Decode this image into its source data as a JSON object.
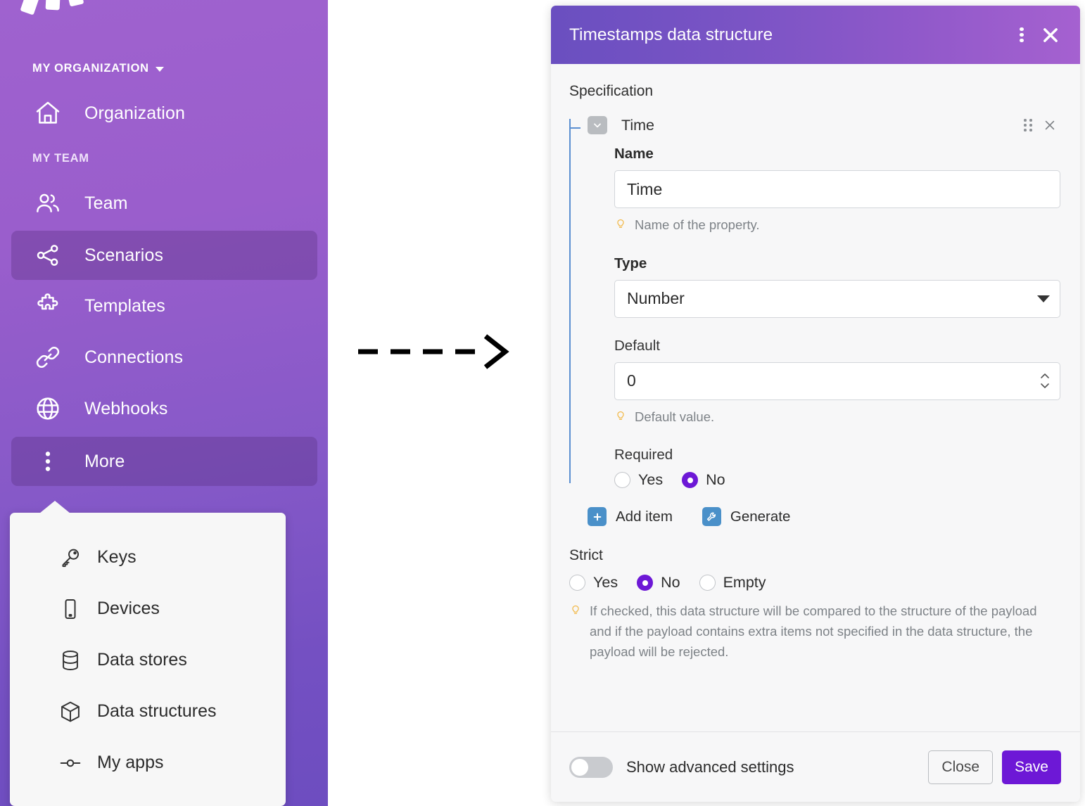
{
  "sidebar": {
    "logo_icon": "make-logo",
    "org_header": {
      "label": "MY ORGANIZATION",
      "icon": "chevron-down-icon"
    },
    "team_header": "MY TEAM",
    "items": [
      {
        "label": "Organization",
        "icon": "home-icon",
        "active": false
      },
      {
        "label": "Team",
        "icon": "people-icon",
        "active": false
      },
      {
        "label": "Scenarios",
        "icon": "share-nodes-icon",
        "active": true
      },
      {
        "label": "Templates",
        "icon": "puzzle-icon",
        "active": false
      },
      {
        "label": "Connections",
        "icon": "link-icon",
        "active": false
      },
      {
        "label": "Webhooks",
        "icon": "globe-icon",
        "active": false
      },
      {
        "label": "More",
        "icon": "kebab-icon",
        "active": true
      }
    ]
  },
  "popup_menu": {
    "items": [
      {
        "label": "Keys",
        "icon": "key-icon"
      },
      {
        "label": "Devices",
        "icon": "device-icon"
      },
      {
        "label": "Data stores",
        "icon": "database-icon"
      },
      {
        "label": "Data structures",
        "icon": "cube-icon"
      },
      {
        "label": "My apps",
        "icon": "node-icon"
      }
    ]
  },
  "flow": {
    "arrow_icon": "dashed-arrow-right-icon"
  },
  "modal": {
    "title": "Timestamps data structure",
    "kebab_icon": "kebab-menu-icon",
    "close_icon": "close-icon",
    "specification_label": "Specification",
    "item": {
      "name": "Time",
      "collapse_icon": "chevron-down-icon",
      "drag_icon": "drag-handle-icon",
      "remove_icon": "close-icon",
      "fields": {
        "name": {
          "label": "Name",
          "value": "Time",
          "hint": "Name of the property.",
          "hint_icon": "lightbulb-icon"
        },
        "type": {
          "label": "Type",
          "value": "Number",
          "caret_icon": "caret-down-icon"
        },
        "default": {
          "label": "Default",
          "value": "0",
          "hint": "Default value.",
          "hint_icon": "lightbulb-icon",
          "stepper_icon": "spinner-arrows-icon"
        },
        "required": {
          "label": "Required",
          "options": [
            {
              "label": "Yes",
              "selected": false
            },
            {
              "label": "No",
              "selected": true
            }
          ]
        }
      }
    },
    "actions": [
      {
        "label": "Add item",
        "icon": "plus-icon"
      },
      {
        "label": "Generate",
        "icon": "wrench-icon"
      }
    ],
    "strict": {
      "label": "Strict",
      "options": [
        {
          "label": "Yes",
          "selected": false
        },
        {
          "label": "No",
          "selected": true
        },
        {
          "label": "Empty",
          "selected": false
        }
      ],
      "hint_icon": "lightbulb-icon",
      "hint": "If checked, this data structure will be compared to the structure of the payload and if the payload contains extra items not specified in the data structure, the payload will be rejected."
    },
    "footer": {
      "advanced_toggle_label": "Show advanced settings",
      "advanced_toggle_on": false,
      "close_label": "Close",
      "save_label": "Save"
    }
  },
  "colors": {
    "sidebar_top": "#9f62cf",
    "sidebar_bottom": "#6d4dc0",
    "header_left": "#6a4fc0",
    "header_right": "#a561d0",
    "accent": "#6d18d6",
    "action_icon": "#4a90c9",
    "tree_line": "#5b8fd1"
  }
}
